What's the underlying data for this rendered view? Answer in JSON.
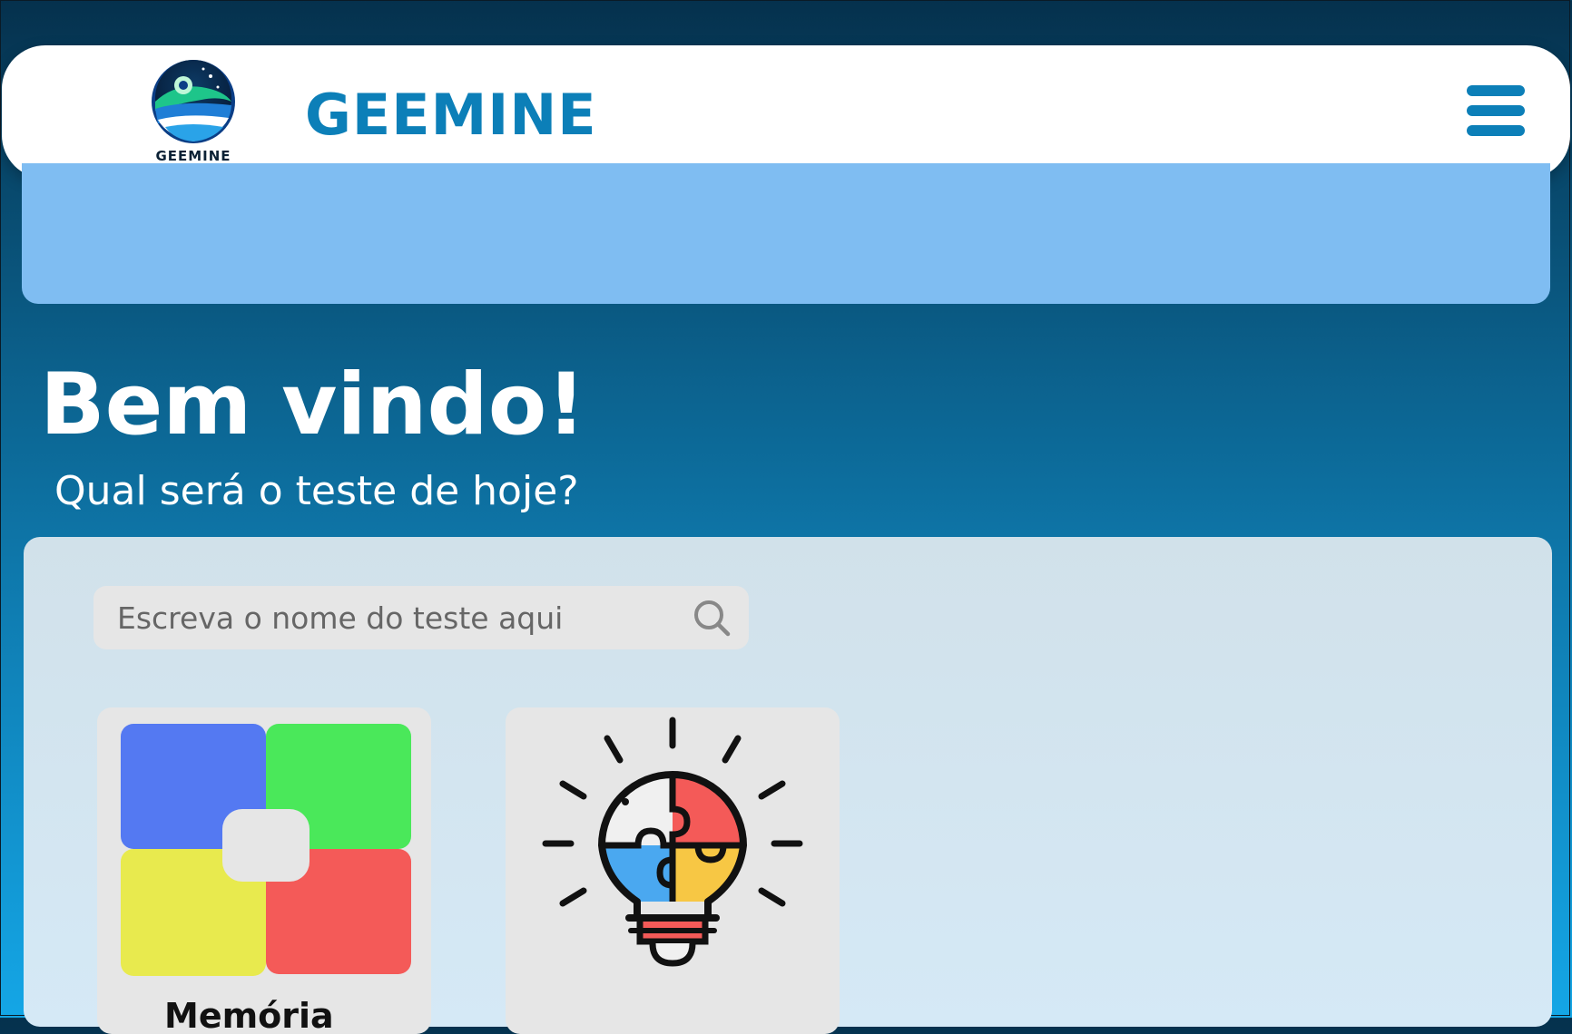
{
  "navbar": {
    "logo_text": "GEEMINE",
    "brand_title": "GEEMINE",
    "menu_icon": "hamburger-menu-icon"
  },
  "hero": {
    "title": "Bem vindo!",
    "subtitle": "Qual será o teste de hoje?"
  },
  "search": {
    "placeholder": "Escreva o nome do teste aqui",
    "icon": "search-icon"
  },
  "cards": [
    {
      "icon": "color-quadrants-icon",
      "label": "Memória"
    },
    {
      "icon": "lightbulb-puzzle-icon"
    }
  ],
  "colors": {
    "brand": "#0c7fb8",
    "banner": "#7fbdf2",
    "quad_blue": "#5479f2",
    "quad_green": "#4ae85a",
    "quad_yellow": "#e8ea4e",
    "quad_red": "#f45a58"
  }
}
